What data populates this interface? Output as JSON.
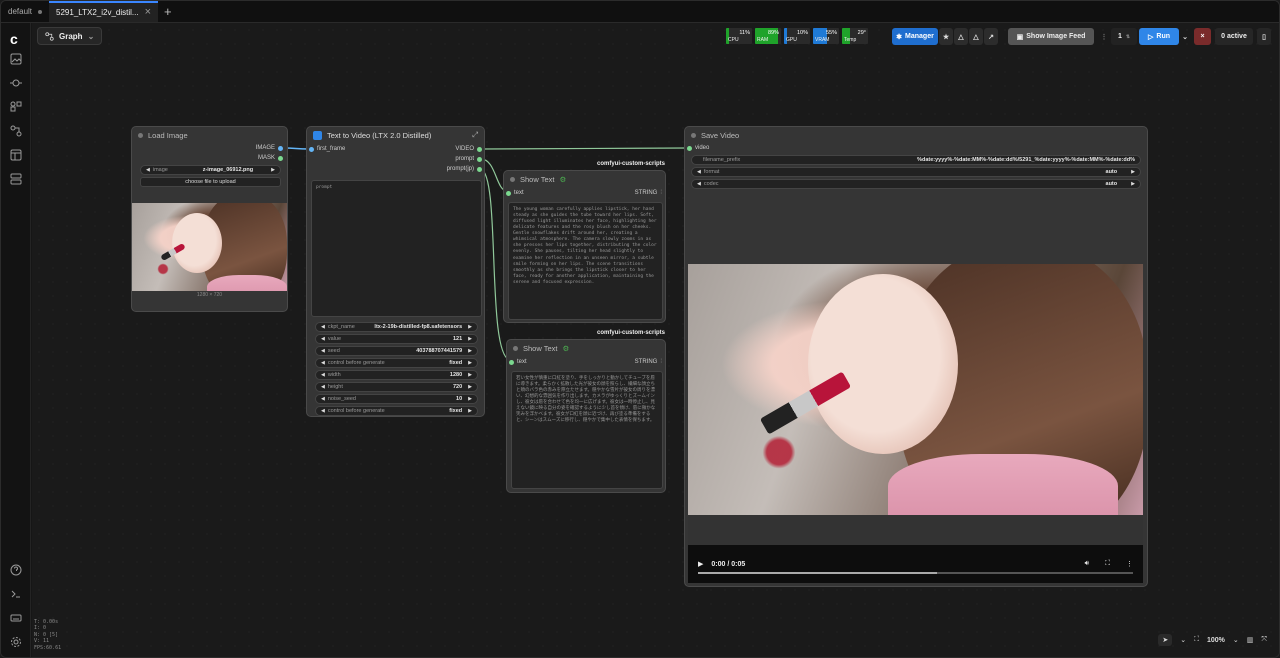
{
  "tabs": [
    {
      "label": "default"
    },
    {
      "label": "5291_LTX2_i2v_distil..."
    }
  ],
  "toolbar": {
    "graph_label": "Graph",
    "resources": [
      {
        "tag": "CPU",
        "value": "11%",
        "fill": 0.11,
        "color": "#1fa32a"
      },
      {
        "tag": "RAM",
        "value": "89%",
        "fill": 0.89,
        "color": "#1fa32a"
      },
      {
        "tag": "GPU",
        "value": "10%",
        "fill": 0.1,
        "color": "#1f7ad6"
      },
      {
        "tag": "VRAM",
        "value": "55%",
        "fill": 0.55,
        "color": "#1f7ad6"
      },
      {
        "tag": "Temp",
        "value": "29°",
        "fill": 0.29,
        "color": "#1fa32a"
      }
    ],
    "manager_label": "Manager",
    "show_image_feed_label": "Show Image Feed",
    "queue_count": "1",
    "run_label": "Run",
    "active_label": "0 active"
  },
  "nodes": {
    "load_image": {
      "title": "Load Image",
      "outputs": [
        "IMAGE",
        "MASK"
      ],
      "image_widget_name": "image",
      "image_widget_value": "z-image_06912.png",
      "upload_label": "choose file to upload",
      "dims": "1280 × 720"
    },
    "text_to_video": {
      "title": "Text to Video (LTX 2.0 Distilled)",
      "input": "first_frame",
      "outputs": [
        "VIDEO",
        "prompt",
        "prompt(jp)"
      ],
      "prompt_placeholder": "prompt",
      "widgets": [
        {
          "name": "ckpt_name",
          "value": "ltx-2-19b-distilled-fp8.safetensors"
        },
        {
          "name": "value",
          "value": "121"
        },
        {
          "name": "seed",
          "value": "403788707441579"
        },
        {
          "name": "control before generate",
          "value": "fixed"
        },
        {
          "name": "width",
          "value": "1280"
        },
        {
          "name": "height",
          "value": "720"
        },
        {
          "name": "noise_seed",
          "value": "10"
        },
        {
          "name": "control before generate",
          "value": "fixed"
        }
      ]
    },
    "show_text_1": {
      "pack": "comfyui-custom-scripts",
      "title": "Show Text",
      "input": "text",
      "output": "STRING",
      "content": "The young woman carefully applies lipstick, her hand steady as she guides the tube toward her lips. Soft, diffused light illuminates her face, highlighting her delicate features and the rosy blush on her cheeks. Gentle snowflakes drift around her, creating a whimsical atmosphere. The camera slowly zooms in as she presses her lips together, distributing the color evenly. She pauses, tilting her head slightly to examine her reflection in an unseen mirror, a subtle smile forming on her lips. The scene transitions smoothly as she brings the lipstick closer to her face, ready for another application, maintaining the serene and focused expression."
    },
    "show_text_2": {
      "pack": "comfyui-custom-scripts",
      "title": "Show Text",
      "input": "text",
      "output": "STRING",
      "content": "若い女性が慎重に口紅を塗り、手をしっかりと動かしてチューブを唇に導きます。柔らかく拡散した光が彼女の顔を照らし、繊細な顔立ちと頬のバラ色の赤みを際立たせます。穏やかな雪片が彼女の周りを漂い、幻想的な雰囲気を作り出します。カメラがゆっくりとズームインし、彼女は唇を合わせて色を均一に広げます。彼女は一時停止し、見えない鏡に映る自分の姿を確認するように少し首を傾け、唇に微かな笑みを浮かべます。彼女が口紅を顔に近づけ、再び塗る準備をすると、シーンはスムーズに移行し、穏やかで集中した表情を保ちます。"
    },
    "save_video": {
      "title": "Save Video",
      "input": "video",
      "widgets": [
        {
          "name": "filename_prefix",
          "value": "%date:yyyy%-%date:MM%-%date:dd%/5291_%date:yyyy%-%date:MM%-%date:dd%"
        },
        {
          "name": "format",
          "value": "auto"
        },
        {
          "name": "codec",
          "value": "auto"
        }
      ],
      "time": "0:00 / 0:05",
      "progress": 0.0
    }
  },
  "bottom": {
    "zoom": "100%",
    "stats": [
      "T: 0.00s",
      "I: 0",
      "N: 0 [5]",
      "V: 11",
      "FPS:60.61"
    ]
  }
}
